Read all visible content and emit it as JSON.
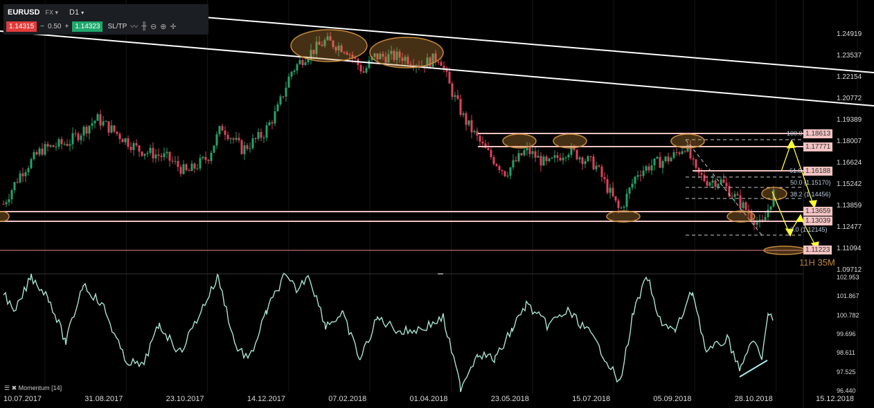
{
  "toolbar": {
    "symbol": "EURUSD",
    "market": "FX",
    "timeframe": "D1",
    "bid": "1.14315",
    "spread_minus": "−",
    "spread": "0.50",
    "spread_plus": "+",
    "ask": "1.14323",
    "sltp": "SL/TP"
  },
  "price_axis": [
    "1.24919",
    "1.23537",
    "1.22154",
    "1.20772",
    "1.19389",
    "1.18007",
    "1.16624",
    "1.15242",
    "1.13859",
    "1.12477",
    "1.11094",
    "1.09712"
  ],
  "momentum_axis": [
    "102.953",
    "101.867",
    "100.782",
    "99.696",
    "98.611",
    "97.525",
    "96.440"
  ],
  "date_axis": [
    "10.07.2017",
    "31.08.2017",
    "23.10.2017",
    "14.12.2017",
    "07.02.2018",
    "01.04.2018",
    "23.05.2018",
    "15.07.2018",
    "05.09.2018",
    "28.10.2018",
    "15.12.2018"
  ],
  "levels": [
    "1.18613",
    "1.17771",
    "1.16188",
    "1.13659",
    "1.13039",
    "1.11223"
  ],
  "fib": [
    "100.0",
    "61.8",
    "50.0 (1.15170)",
    "38.2 (1.14456)",
    "0.0 (1.12145)"
  ],
  "timer": {
    "hours": "11H",
    "minutes": "35M"
  },
  "indicator": {
    "name": "Momentum [14]"
  },
  "colors": {
    "up": "#26a269",
    "down": "#e0425a",
    "momentum": "#a8e6cf",
    "ellipse": "#c98a3c",
    "level": "#f4c3c3"
  }
}
